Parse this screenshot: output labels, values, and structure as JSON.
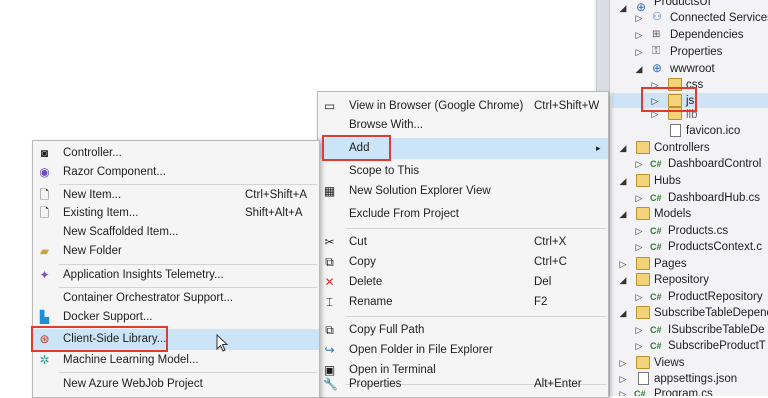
{
  "solution_explorer": {
    "items": [
      {
        "label": "ProductsUI",
        "icon": "web-project-icon"
      },
      {
        "label": "Connected Services",
        "icon": "connected-services-icon"
      },
      {
        "label": "Dependencies",
        "icon": "dependencies-icon"
      },
      {
        "label": "Properties",
        "icon": "properties-icon"
      },
      {
        "label": "wwwroot",
        "icon": "globe-icon"
      },
      {
        "label": "css",
        "icon": "folder-icon"
      },
      {
        "label": "js",
        "icon": "folder-icon"
      },
      {
        "label": "lib",
        "icon": "folder-icon"
      },
      {
        "label": "favicon.ico",
        "icon": "file-icon"
      },
      {
        "label": "Controllers",
        "icon": "folder-icon"
      },
      {
        "label": "DashboardControl",
        "icon": "csharp-icon"
      },
      {
        "label": "Hubs",
        "icon": "folder-icon"
      },
      {
        "label": "DashboardHub.cs",
        "icon": "csharp-icon"
      },
      {
        "label": "Models",
        "icon": "folder-icon"
      },
      {
        "label": "Products.cs",
        "icon": "csharp-icon"
      },
      {
        "label": "ProductsContext.c",
        "icon": "csharp-icon"
      },
      {
        "label": "Pages",
        "icon": "folder-icon"
      },
      {
        "label": "Repository",
        "icon": "folder-icon"
      },
      {
        "label": "ProductRepository",
        "icon": "csharp-icon"
      },
      {
        "label": "SubscribeTableDepend",
        "icon": "folder-icon"
      },
      {
        "label": "ISubscribeTableDe",
        "icon": "csharp-icon"
      },
      {
        "label": "SubscribeProductT",
        "icon": "csharp-icon"
      },
      {
        "label": "Views",
        "icon": "folder-icon"
      },
      {
        "label": "appsettings.json",
        "icon": "json-file-icon"
      },
      {
        "label": "Program.cs",
        "icon": "csharp-icon"
      }
    ],
    "cs_tag": "C#"
  },
  "context_menu": {
    "items": [
      {
        "label": "View in Browser (Google Chrome)",
        "shortcut": "Ctrl+Shift+W",
        "icon": "browser-icon"
      },
      {
        "label": "Browse With...",
        "shortcut": "",
        "icon": ""
      },
      {
        "label": "Add",
        "shortcut": "",
        "icon": "",
        "submenu_arrow": "▸"
      },
      {
        "label": "Scope to This",
        "shortcut": "",
        "icon": ""
      },
      {
        "label": "New Solution Explorer View",
        "shortcut": "",
        "icon": "new-view-icon"
      },
      {
        "label": "Exclude From Project",
        "shortcut": "",
        "icon": ""
      },
      {
        "label": "Cut",
        "shortcut": "Ctrl+X",
        "icon": "cut-icon"
      },
      {
        "label": "Copy",
        "shortcut": "Ctrl+C",
        "icon": "copy-icon"
      },
      {
        "label": "Delete",
        "shortcut": "Del",
        "icon": "delete-icon"
      },
      {
        "label": "Rename",
        "shortcut": "F2",
        "icon": "rename-icon"
      },
      {
        "label": "Copy Full Path",
        "shortcut": "",
        "icon": "copy-path-icon"
      },
      {
        "label": "Open Folder in File Explorer",
        "shortcut": "",
        "icon": "open-folder-icon"
      },
      {
        "label": "Open in Terminal",
        "shortcut": "",
        "icon": "terminal-icon"
      },
      {
        "label": "Properties",
        "shortcut": "Alt+Enter",
        "icon": "wrench-icon"
      }
    ]
  },
  "add_submenu": {
    "items": [
      {
        "label": "Controller...",
        "shortcut": "",
        "icon": "controller-icon"
      },
      {
        "label": "Razor Component...",
        "shortcut": "",
        "icon": "razor-icon"
      },
      {
        "label": "New Item...",
        "shortcut": "Ctrl+Shift+A",
        "icon": "new-item-icon"
      },
      {
        "label": "Existing Item...",
        "shortcut": "Shift+Alt+A",
        "icon": "existing-item-icon"
      },
      {
        "label": "New Scaffolded Item...",
        "shortcut": "",
        "icon": ""
      },
      {
        "label": "New Folder",
        "shortcut": "",
        "icon": "new-folder-icon"
      },
      {
        "label": "Application Insights Telemetry...",
        "shortcut": "",
        "icon": "app-insights-icon"
      },
      {
        "label": "Container Orchestrator Support...",
        "shortcut": "",
        "icon": ""
      },
      {
        "label": "Docker Support...",
        "shortcut": "",
        "icon": "docker-icon"
      },
      {
        "label": "Client-Side Library...",
        "shortcut": "",
        "icon": "client-library-icon"
      },
      {
        "label": "Machine Learning Model...",
        "shortcut": "",
        "icon": "ml-model-icon"
      },
      {
        "label": "New Azure WebJob Project",
        "shortcut": "",
        "icon": ""
      }
    ]
  },
  "colors": {
    "highlight_box": "#e23b2e",
    "menu_highlight": "#cce4f7"
  }
}
